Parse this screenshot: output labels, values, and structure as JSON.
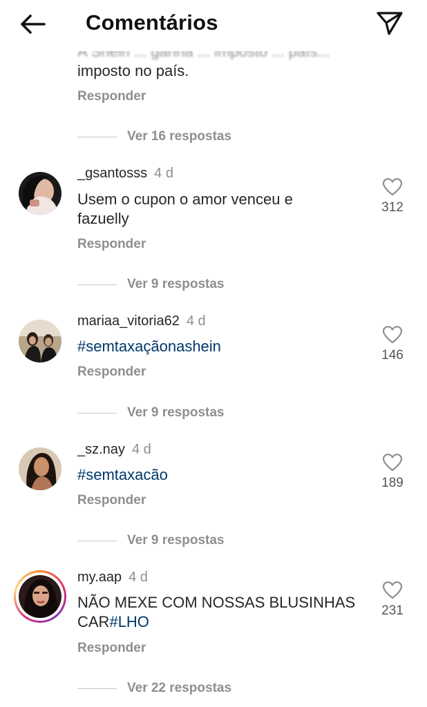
{
  "header": {
    "title": "Comentários",
    "back_icon": "arrow-left-icon",
    "send_icon": "paper-plane-icon"
  },
  "top": {
    "partial_text": "A Shein ... ganha ... imposto ... país...",
    "text_line": "imposto no país.",
    "reply_label": "Responder",
    "view_replies": "Ver 16 respostas"
  },
  "comments": [
    {
      "username": "_gsantosss",
      "time": "4 d",
      "text_before": "Usem o cupon o amor venceu e",
      "text_line2": "fazuelly",
      "likes": "312",
      "reply_label": "Responder",
      "view_replies": "Ver 9 respostas"
    },
    {
      "username": "mariaa_vitoria62",
      "time": "4 d",
      "hashtag": "#semtaxaçãonashein",
      "likes": "146",
      "reply_label": "Responder",
      "view_replies": "Ver 9 respostas"
    },
    {
      "username": "_sz.nay",
      "time": "4 d",
      "hashtag": "#semtaxacão",
      "likes": "189",
      "reply_label": "Responder",
      "view_replies": "Ver 9 respostas"
    },
    {
      "username": "my.aap",
      "time": "4 d",
      "text_before": "NÃO MEXE COM NOSSAS BLUSINHAS",
      "text_line2_prefix": "CAR",
      "hashtag": "#LHO",
      "likes": "231",
      "reply_label": "Responder",
      "view_replies": "Ver 22 respostas"
    }
  ],
  "colors": {
    "hashtag": "#00376b",
    "secondary_text": "#8e8e8e",
    "story_ring": [
      "#f58529",
      "#dd2a7b",
      "#8134af"
    ]
  }
}
